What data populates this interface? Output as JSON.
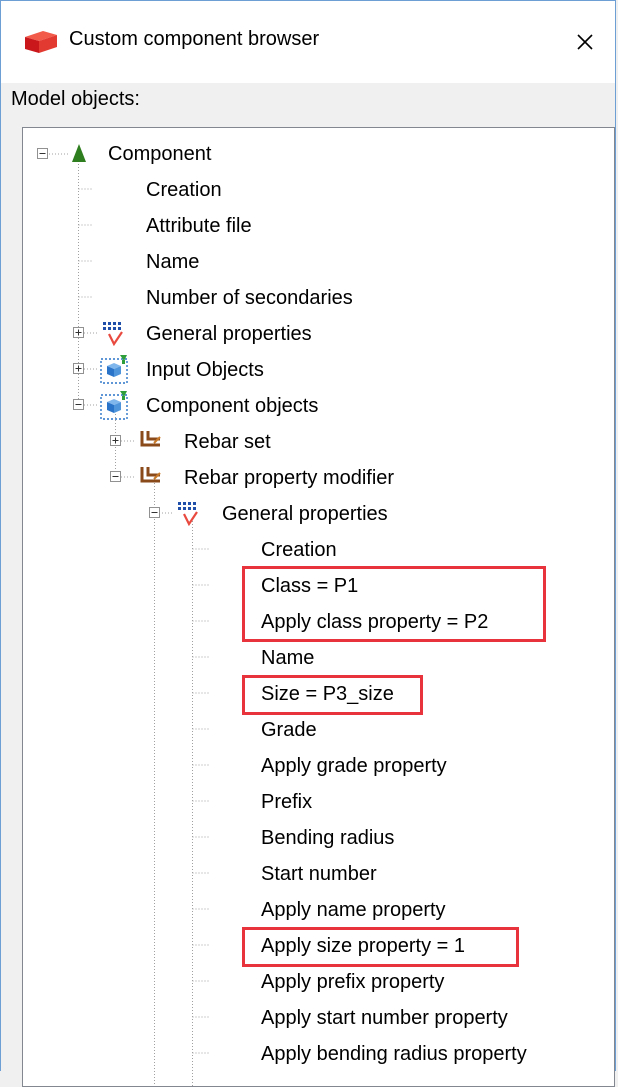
{
  "window": {
    "title": "Custom component browser",
    "close_glyph": "✕"
  },
  "section_label": "Model objects:",
  "tree": {
    "root": "Component",
    "root_children": [
      "Creation",
      "Attribute file",
      "Name",
      "Number of secondaries"
    ],
    "general_properties": "General properties",
    "input_objects": "Input Objects",
    "component_objects": "Component objects",
    "rebar_set": "Rebar set",
    "rebar_property_modifier": "Rebar property modifier",
    "modifier_general_properties": "General properties",
    "properties": [
      "Creation",
      "Class = P1",
      "Apply class property = P2",
      "Name",
      "Size = P3_size",
      "Grade",
      "Apply grade property",
      "Prefix",
      "Bending radius",
      "Start number",
      "Apply name property",
      "Apply size property = 1",
      "Apply prefix property",
      "Apply start number property",
      "Apply bending radius property"
    ]
  },
  "colors": {
    "highlight": "#e8323c",
    "selection_border": "#6e9fd4"
  }
}
